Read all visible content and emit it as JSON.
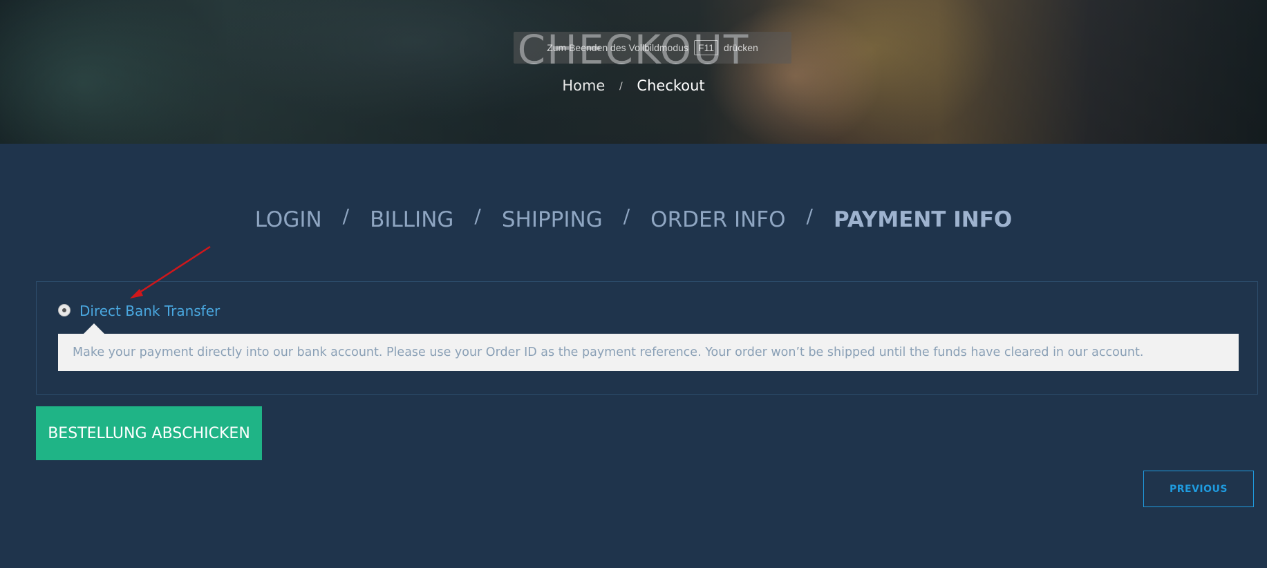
{
  "hero": {
    "title": "CHECKOUT",
    "fullscreen_notice": {
      "before": "Zum Beenden des Vollbildmodus",
      "key": "F11",
      "after": "drücken"
    },
    "breadcrumb": {
      "home": "Home",
      "separator": "/",
      "current": "Checkout"
    }
  },
  "steps": {
    "items": [
      "LOGIN",
      "BILLING",
      "SHIPPING",
      "ORDER INFO",
      "PAYMENT INFO"
    ],
    "separator": "/",
    "active_index": 4
  },
  "payment": {
    "method_label": "Direct Bank Transfer",
    "selected": true,
    "description": "Make your payment directly into our bank account. Please use your Order ID as the payment reference. Your order won’t be shipped until the funds have cleared in our account."
  },
  "actions": {
    "submit_label": "BESTELLUNG ABSCHICKEN",
    "previous_label": "PREVIOUS"
  },
  "colors": {
    "page_background": "#1f344c",
    "accent_green": "#1fb486",
    "accent_blue": "#1f9ce0",
    "link_blue": "#4aa8e0",
    "step_text": "#8fa6c2",
    "annotation_arrow": "#d0171b"
  },
  "icons": {
    "annotation": "red-arrow-icon",
    "radio": "radio-selected-icon"
  }
}
